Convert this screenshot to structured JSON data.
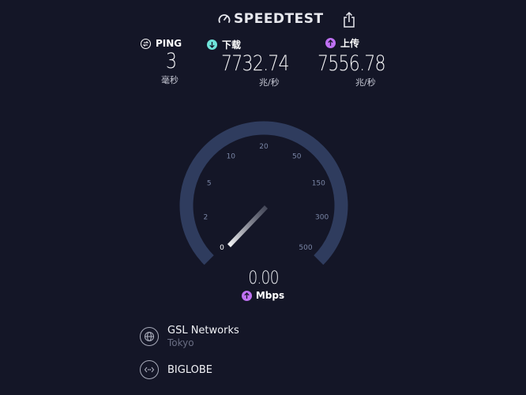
{
  "header": {
    "brand": "SPEEDTEST",
    "brand_icon": "speedometer-icon",
    "share_icon": "share-icon"
  },
  "stats": {
    "ping": {
      "label": "PING",
      "value": "3",
      "unit": "毫秒",
      "icon": "ping-icon",
      "color": "#ffffff"
    },
    "download": {
      "label": "下载",
      "value": "7732.74",
      "unit": "兆/秒",
      "icon": "download-arrow-icon",
      "color": "#6fe3d9"
    },
    "upload": {
      "label": "上传",
      "value": "7556.78",
      "unit": "兆/秒",
      "icon": "upload-arrow-icon",
      "color": "#bf71f2"
    }
  },
  "gauge": {
    "ticks": [
      "0",
      "2",
      "5",
      "10",
      "20",
      "50",
      "150",
      "300",
      "500"
    ],
    "current_value": "0.00",
    "unit": "Mbps",
    "needle_value": 0,
    "arc_color": "#2f3c5e"
  },
  "servers": {
    "host": {
      "name": "GSL Networks",
      "location": "Tokyo",
      "icon": "globe-icon"
    },
    "isp": {
      "name": "BIGLOBE",
      "icon": "connection-icon"
    }
  }
}
